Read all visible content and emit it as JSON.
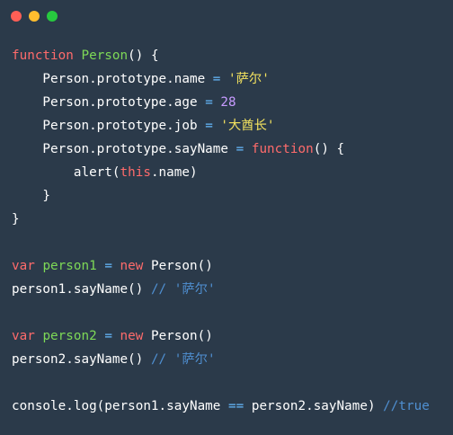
{
  "window": {
    "controls": {
      "close_color": "#ff5f56",
      "minimize_color": "#ffbd2e",
      "maximize_color": "#27c93f"
    }
  },
  "code": {
    "lines": [
      [
        {
          "t": "function",
          "k": "kw"
        },
        {
          "t": " ",
          "k": "pl"
        },
        {
          "t": "Person",
          "k": "fn"
        },
        {
          "t": "() {",
          "k": "pl"
        }
      ],
      [
        {
          "t": "    Person.prototype.name ",
          "k": "pl"
        },
        {
          "t": "=",
          "k": "op"
        },
        {
          "t": " ",
          "k": "pl"
        },
        {
          "t": "'萨尔'",
          "k": "str"
        }
      ],
      [
        {
          "t": "    Person.prototype.age ",
          "k": "pl"
        },
        {
          "t": "=",
          "k": "op"
        },
        {
          "t": " ",
          "k": "pl"
        },
        {
          "t": "28",
          "k": "num"
        }
      ],
      [
        {
          "t": "    Person.prototype.job ",
          "k": "pl"
        },
        {
          "t": "=",
          "k": "op"
        },
        {
          "t": " ",
          "k": "pl"
        },
        {
          "t": "'大酋长'",
          "k": "str"
        }
      ],
      [
        {
          "t": "    Person.prototype.sayName ",
          "k": "pl"
        },
        {
          "t": "=",
          "k": "op"
        },
        {
          "t": " ",
          "k": "pl"
        },
        {
          "t": "function",
          "k": "kw"
        },
        {
          "t": "() {",
          "k": "pl"
        }
      ],
      [
        {
          "t": "        alert(",
          "k": "pl"
        },
        {
          "t": "this",
          "k": "kw"
        },
        {
          "t": ".name)",
          "k": "pl"
        }
      ],
      [
        {
          "t": "    }",
          "k": "pl"
        }
      ],
      [
        {
          "t": "}",
          "k": "pl"
        }
      ],
      [],
      [
        {
          "t": "var",
          "k": "kw"
        },
        {
          "t": " ",
          "k": "pl"
        },
        {
          "t": "person1",
          "k": "fn"
        },
        {
          "t": " ",
          "k": "pl"
        },
        {
          "t": "=",
          "k": "op"
        },
        {
          "t": " ",
          "k": "pl"
        },
        {
          "t": "new",
          "k": "kw"
        },
        {
          "t": " Person()",
          "k": "pl"
        }
      ],
      [
        {
          "t": "person1.sayName() ",
          "k": "pl"
        },
        {
          "t": "// '萨尔'",
          "k": "cm"
        }
      ],
      [],
      [
        {
          "t": "var",
          "k": "kw"
        },
        {
          "t": " ",
          "k": "pl"
        },
        {
          "t": "person2",
          "k": "fn"
        },
        {
          "t": " ",
          "k": "pl"
        },
        {
          "t": "=",
          "k": "op"
        },
        {
          "t": " ",
          "k": "pl"
        },
        {
          "t": "new",
          "k": "kw"
        },
        {
          "t": " Person()",
          "k": "pl"
        }
      ],
      [
        {
          "t": "person2.sayName() ",
          "k": "pl"
        },
        {
          "t": "// '萨尔'",
          "k": "cm"
        }
      ],
      [],
      [
        {
          "t": "console.log(person1.sayName ",
          "k": "pl"
        },
        {
          "t": "==",
          "k": "op"
        },
        {
          "t": " person2.sayName) ",
          "k": "pl"
        },
        {
          "t": "//true",
          "k": "cm"
        }
      ]
    ]
  }
}
